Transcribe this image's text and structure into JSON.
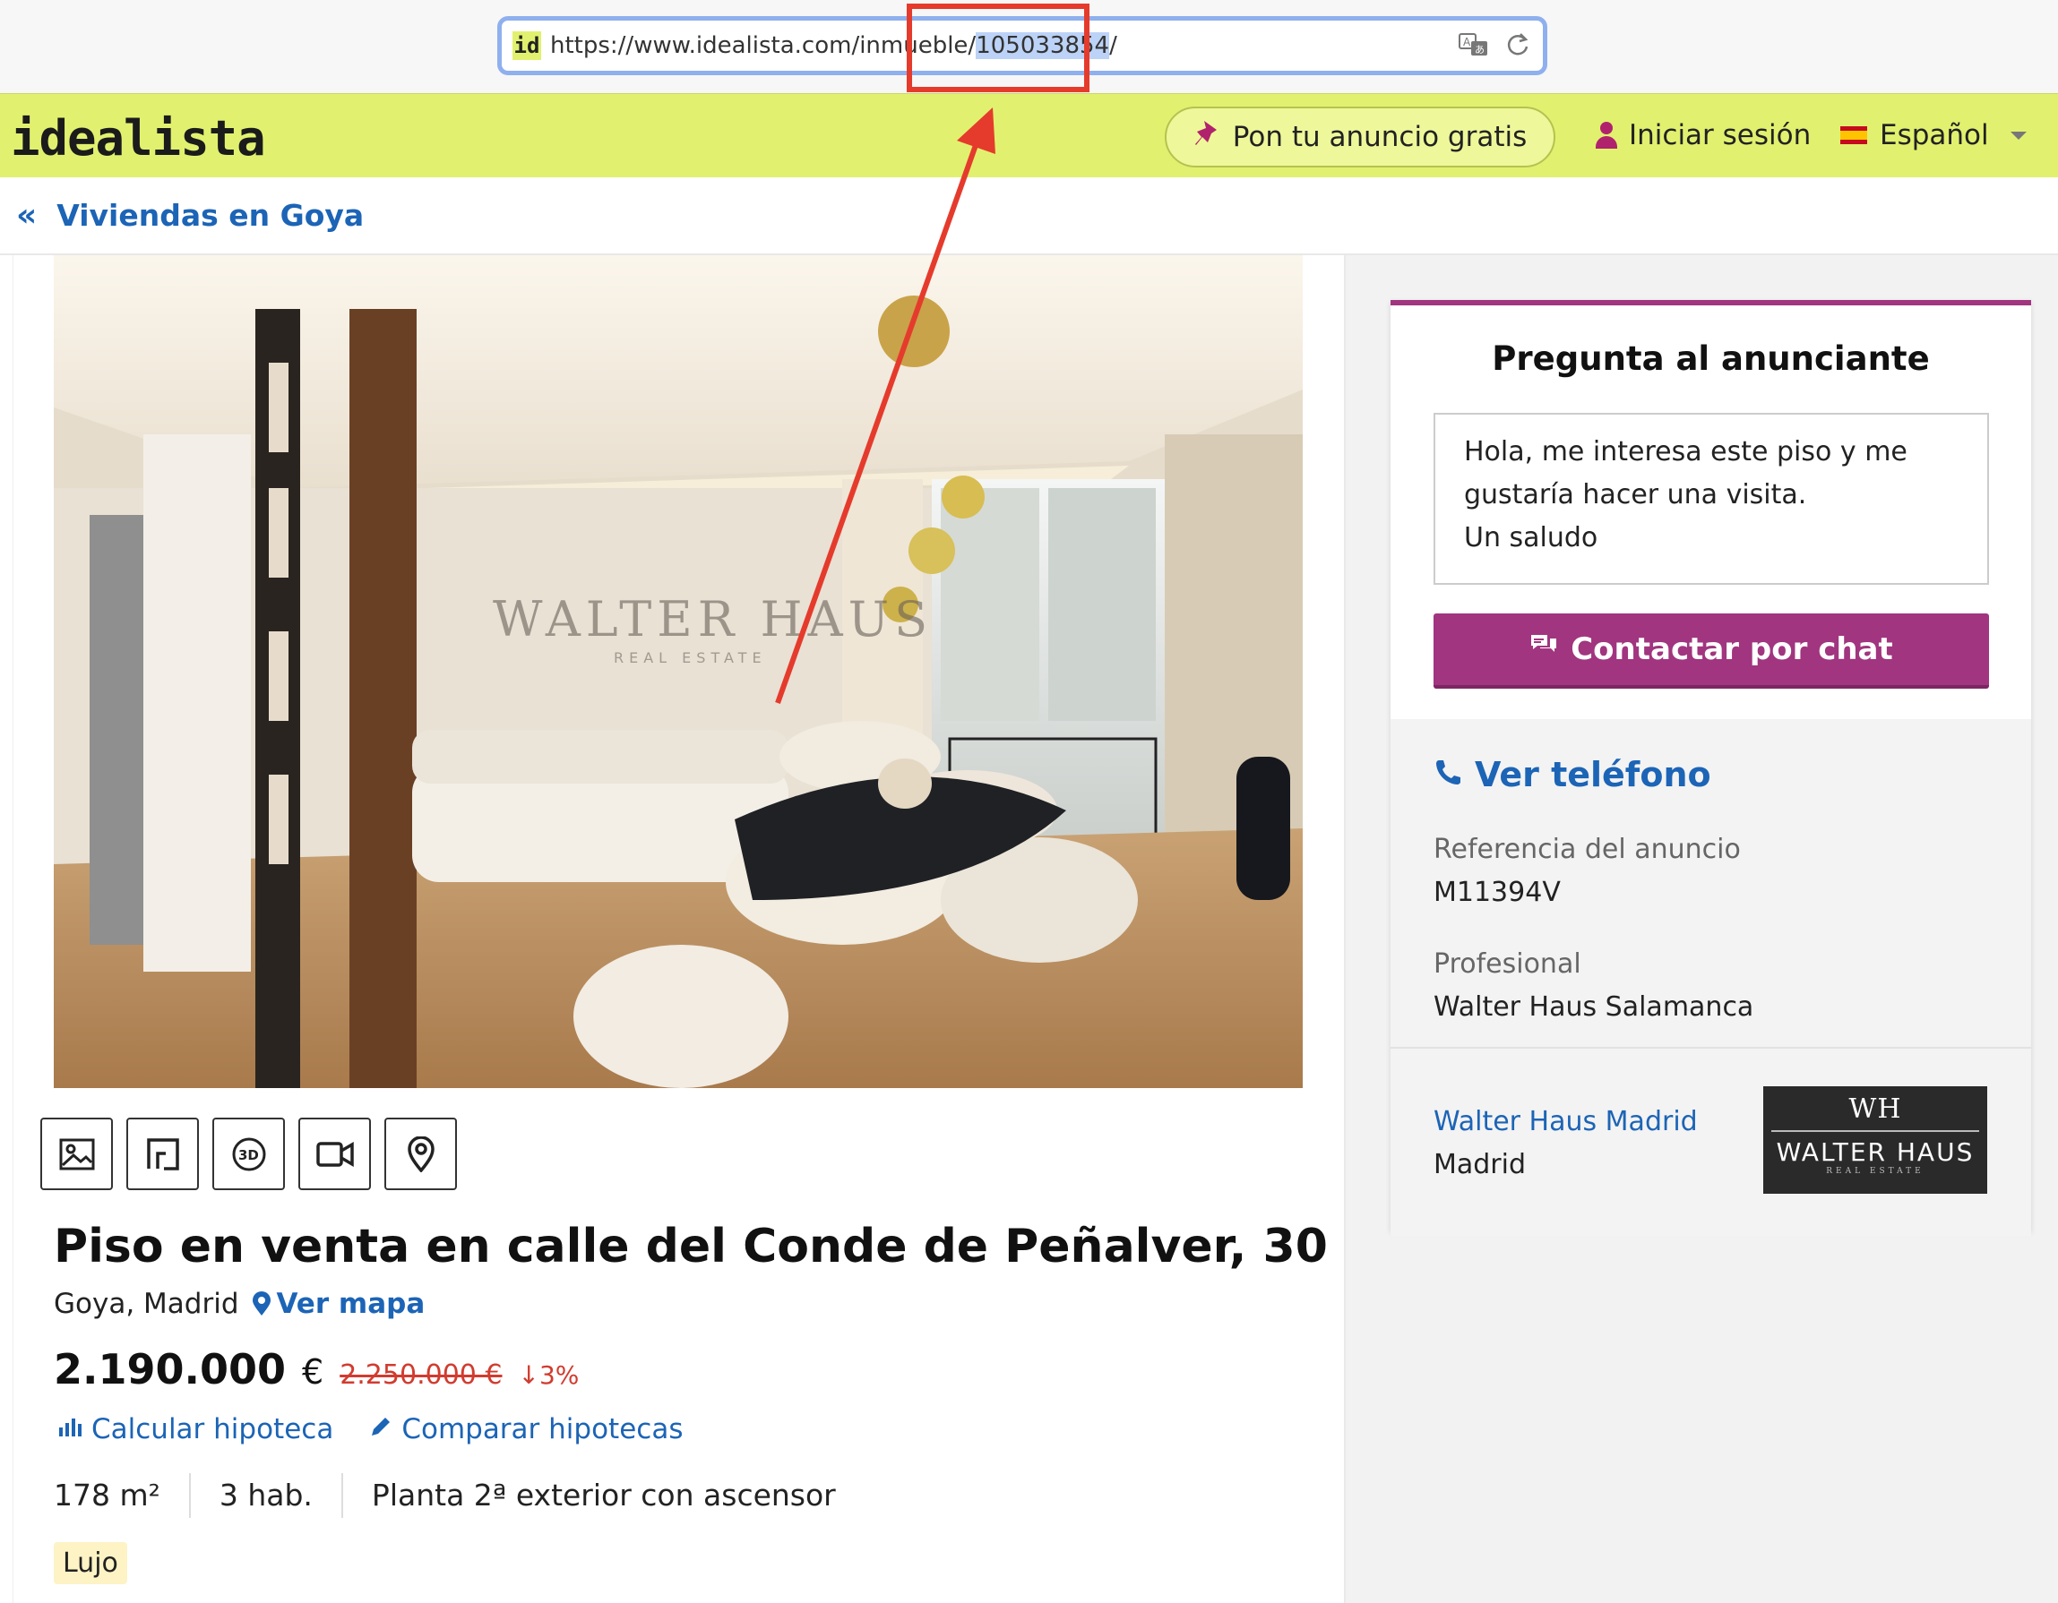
{
  "browser": {
    "favicon": "id",
    "url_prefix": "https://www.idealista.com/inmueble/",
    "url_selected": "105033854",
    "url_suffix": "/",
    "icons": [
      "translate-icon",
      "reload-icon"
    ]
  },
  "header": {
    "logo": "idealista",
    "post_ad_label": "Pon tu anuncio gratis",
    "login_label": "Iniciar sesión",
    "language_label": "Español",
    "brand_color": "#e1f16f",
    "accent_color": "#a1357f"
  },
  "breadcrumb": {
    "back_label": "Viviendas en Goya"
  },
  "listing": {
    "photo_watermark": "WALTER HAUS",
    "photo_watermark_sub": "REAL ESTATE",
    "media_buttons": [
      "photos-icon",
      "floorplan-icon",
      "3d-tour-icon",
      "video-icon",
      "map-pin-icon"
    ],
    "title": "Piso en venta en calle del Conde de Peñalver, 30",
    "location": "Goya, Madrid",
    "map_link": "Ver mapa",
    "price": "2.190.000",
    "currency": "€",
    "old_price": "2.250.000 €",
    "price_drop": "3%",
    "tools": {
      "calc_mortgage": "Calcular hipoteca",
      "compare_mortgage": "Comparar hipotecas"
    },
    "features": [
      "178 m²",
      "3 hab.",
      "Planta 2ª exterior con ascensor"
    ],
    "tag": "Lujo"
  },
  "contact": {
    "title": "Pregunta al anunciante",
    "message_line1": "Hola, me interesa este piso y me",
    "message_line2": "gustaría hacer una visita.",
    "message_line3": "Un saludo",
    "chat_button": "Contactar por chat",
    "phone_link": "Ver teléfono",
    "ref_label": "Referencia del anuncio",
    "ref_value": "M11394V",
    "pro_label": "Profesional",
    "pro_value": "Walter Haus Salamanca",
    "agency_name": "Walter Haus Madrid",
    "agency_city": "Madrid",
    "agency_logo_mark": "WH",
    "agency_logo_name": "WALTER HAUS",
    "agency_logo_sub": "REAL ESTATE"
  },
  "annotation": {
    "color": "#e53b2c"
  }
}
